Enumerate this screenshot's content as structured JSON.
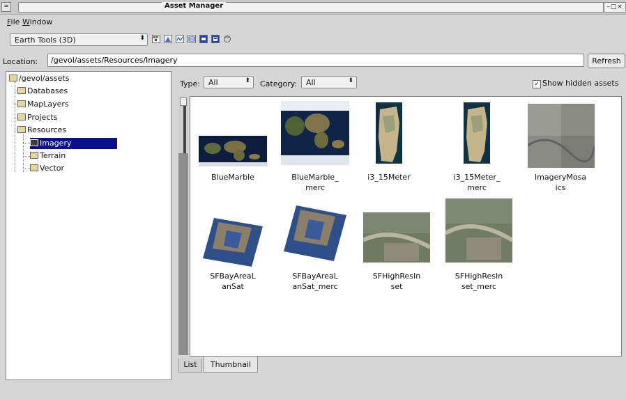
{
  "window": {
    "title": "Asset Manager",
    "left_control": "=",
    "controls": "–□×"
  },
  "menu": [
    {
      "label": "File",
      "mnemonic": "F"
    },
    {
      "label": "Window",
      "mnemonic": "W"
    }
  ],
  "toolbar": {
    "tool_select_value": "Earth Tools (3D)",
    "icons": [
      "imagery-resource-icon",
      "terrain-resource-icon",
      "vector-resource-icon",
      "mosaic-icon",
      "database-icon",
      "map-database-icon",
      "globe-icon"
    ]
  },
  "location": {
    "label": "Location:",
    "value": "/gevol/assets/Resources/Imagery",
    "refresh_label": "Refresh"
  },
  "tree": {
    "root": "/gevol/assets",
    "items": [
      "Databases",
      "MapLayers",
      "Projects",
      "Resources",
      "Imagery",
      "Terrain",
      "Vector"
    ],
    "selected": "Imagery"
  },
  "filters": {
    "type_label": "Type:",
    "type_value": "All",
    "category_label": "Category:",
    "category_value": "All",
    "show_hidden_label": "Show hidden assets",
    "show_hidden_checked": true
  },
  "thumbnails": [
    {
      "line1": "BlueMarble",
      "line2": ""
    },
    {
      "line1": "BlueMarble_",
      "line2": "merc"
    },
    {
      "line1": "i3_15Meter",
      "line2": ""
    },
    {
      "line1": "i3_15Meter_",
      "line2": "merc"
    },
    {
      "line1": "ImageryMosa",
      "line2": "ics"
    },
    {
      "line1": "SFBayAreaL",
      "line2": "anSat"
    },
    {
      "line1": "SFBayAreaL",
      "line2": "anSat_merc"
    },
    {
      "line1": "SFHighResIn",
      "line2": "set"
    },
    {
      "line1": "SFHighResIn",
      "line2": "set_merc"
    }
  ],
  "tabs": {
    "list": "List",
    "thumbnail": "Thumbnail",
    "active": "Thumbnail"
  },
  "colors": {
    "selection": "#0a0f8a",
    "window_bg": "#d6d6d6"
  }
}
